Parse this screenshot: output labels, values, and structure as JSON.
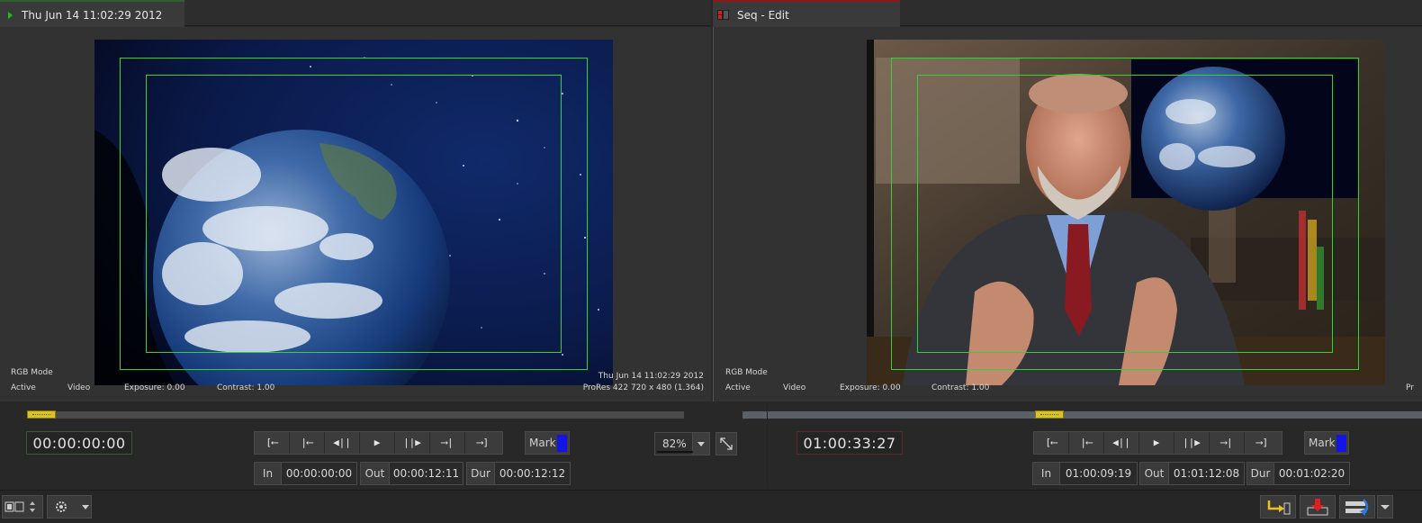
{
  "source": {
    "tab_title": "Thu Jun 14 11:02:29 2012",
    "overlay": {
      "mode": "RGB Mode",
      "status": "Active",
      "track": "Video",
      "exposure": "Exposure: 0.00",
      "contrast": "Contrast: 1.00",
      "clip_name": "Thu Jun 14 11:02:29 2012",
      "format": "ProRes 422 720 x 480 (1.364)"
    },
    "playhead_position": 0.0,
    "timecode": "00:00:00:00",
    "mark_label": "Mark",
    "in_label": "In",
    "in_value": "00:00:00:00",
    "out_label": "Out",
    "out_value": "00:00:12:11",
    "dur_label": "Dur",
    "dur_value": "00:00:12:12"
  },
  "record": {
    "tab_title": "Seq - Edit",
    "overlay": {
      "mode": "RGB Mode",
      "status": "Active",
      "track": "Video",
      "exposure": "Exposure: 0.00",
      "contrast": "Contrast: 1.00",
      "format_partial": "Pr"
    },
    "playhead_position": 0.45,
    "timecode": "01:00:33:27",
    "mark_label": "Mark",
    "in_label": "In",
    "in_value": "01:00:09:19",
    "out_label": "Out",
    "out_value": "01:01:12:08",
    "dur_label": "Dur",
    "dur_value": "00:01:02:20"
  },
  "transport": {
    "go_to_in": "[⟵",
    "prev_edit": "|⟵",
    "step_back": "◀||",
    "play": "▶",
    "step_forward": "||▶",
    "next_edit": "⟶|",
    "go_to_out": "⟶]"
  },
  "zoom": {
    "value": "82%"
  },
  "colors": {
    "safe_guide": "#2fd62f",
    "mark_blue": "#1414e6",
    "playhead": "#d8c22a"
  }
}
